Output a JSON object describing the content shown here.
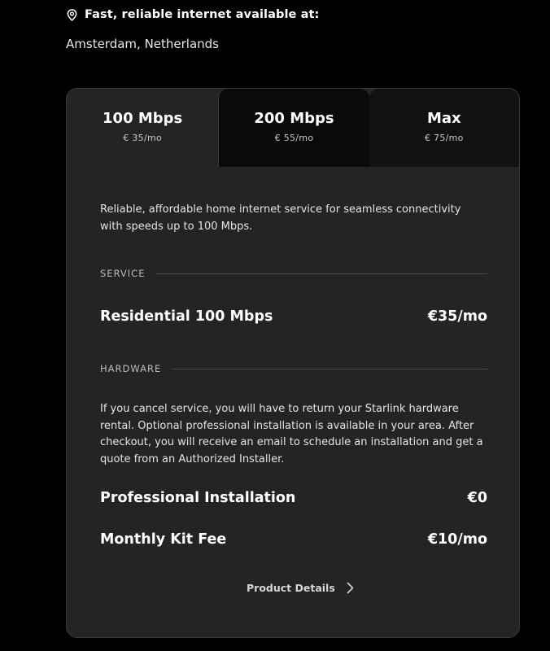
{
  "location": {
    "icon": "map-pin-icon",
    "title": "Fast, reliable internet available at:",
    "city": "Amsterdam, Netherlands"
  },
  "plans": {
    "selected_index": 0,
    "tabs": [
      {
        "name": "100 Mbps",
        "price": "€ 35/mo"
      },
      {
        "name": "200 Mbps",
        "price": "€ 55/mo"
      },
      {
        "name": "Max",
        "price": "€ 75/mo"
      }
    ]
  },
  "plan_detail": {
    "description": "Reliable, affordable home internet service for seamless connectivity with speeds up to 100 Mbps.",
    "service": {
      "heading": "SERVICE",
      "item_name": "Residential 100 Mbps",
      "item_price": "€35/mo"
    },
    "hardware": {
      "heading": "HARDWARE",
      "text": "If you cancel service, you will have to return your Starlink hardware rental. Optional professional installation is available in your area. After checkout, you will receive an email to schedule an installation and get a quote from an Authorized Installer.",
      "installation_name": "Professional Installation",
      "installation_price": "€0",
      "kit_fee_name": "Monthly Kit Fee",
      "kit_fee_price": "€10/mo"
    },
    "details_link": {
      "label": "Product Details",
      "icon": "chevron-right-icon"
    }
  },
  "colors": {
    "background": "#000000",
    "card": "#242424",
    "tab_inactive": "#0a0a0a",
    "text_primary": "#ffffff",
    "text_secondary": "#bdbdbd"
  }
}
